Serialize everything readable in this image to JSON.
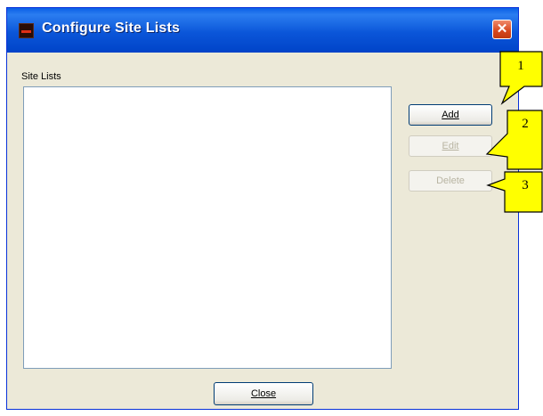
{
  "window": {
    "title": "Configure Site Lists",
    "close_glyph": "✕",
    "icon": "app-icon"
  },
  "site_lists": {
    "label": "Site Lists",
    "items": []
  },
  "buttons": {
    "add": "Add",
    "edit": "Edit",
    "delete": "Delete",
    "close": "Close"
  },
  "callouts": [
    {
      "number": "1",
      "target": "add-button"
    },
    {
      "number": "2",
      "target": "edit-button"
    },
    {
      "number": "3",
      "target": "delete-button"
    }
  ],
  "colors": {
    "callout_fill": "#ffff00",
    "titlebar": "#0b56d9",
    "window_bg": "#ece9d8"
  }
}
